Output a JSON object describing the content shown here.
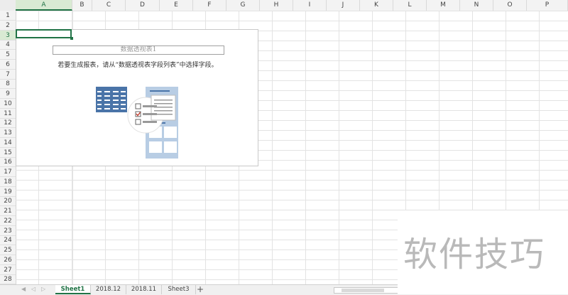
{
  "columns": [
    "A",
    "B",
    "C",
    "D",
    "E",
    "F",
    "G",
    "H",
    "I",
    "J",
    "K",
    "L",
    "M",
    "N",
    "O",
    "P"
  ],
  "rows": [
    "1",
    "2",
    "3",
    "4",
    "5",
    "6",
    "7",
    "8",
    "9",
    "10",
    "11",
    "12",
    "13",
    "14",
    "15",
    "16",
    "17",
    "18",
    "19",
    "20",
    "21",
    "22",
    "23",
    "24",
    "25",
    "26",
    "27",
    "28"
  ],
  "active_column": "A",
  "active_row": "3",
  "pivot": {
    "title": "数据透视表1",
    "message": "若要生成报表，请从“数据透视表字段列表”中选择字段。"
  },
  "sheet_tabs": [
    {
      "label": "Sheet1",
      "active": true
    },
    {
      "label": "2018.12",
      "active": false
    },
    {
      "label": "2018.11",
      "active": false
    },
    {
      "label": "Sheet3",
      "active": false
    }
  ],
  "add_sheet_label": "+",
  "watermark": "软件技巧",
  "colors": {
    "accent": "#217346",
    "illustration": "#4a74a8"
  }
}
